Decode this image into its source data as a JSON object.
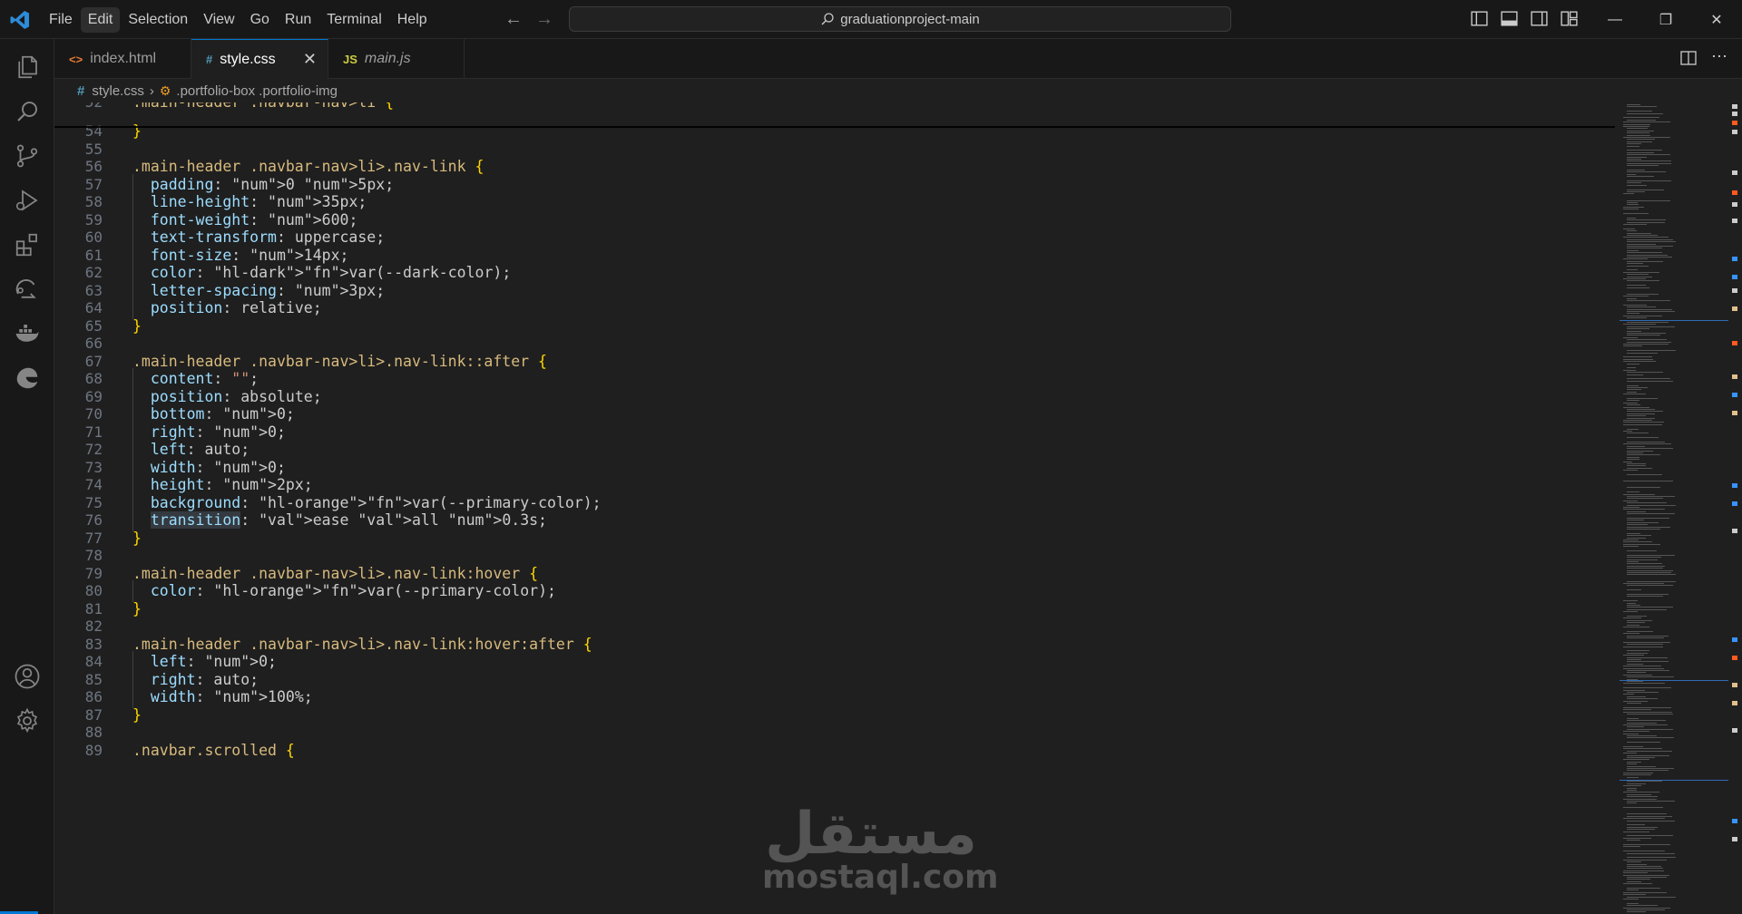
{
  "titlebar": {
    "menu": [
      "File",
      "Edit",
      "Selection",
      "View",
      "Go",
      "Run",
      "Terminal",
      "Help"
    ],
    "search_text": "graduationproject-main",
    "window_controls": [
      "minimize-icon",
      "restore-icon",
      "close-icon"
    ]
  },
  "activity_bar": [
    "explorer-icon",
    "search-icon",
    "source-control-icon",
    "run-debug-icon",
    "extensions-icon",
    "remote-explorer-icon",
    "docker-icon",
    "edge-icon",
    "accounts-icon",
    "manage-gear-icon"
  ],
  "tabs": [
    {
      "icon": "<>",
      "label": "index.html",
      "active": false
    },
    {
      "icon": "#",
      "label": "style.css",
      "active": true
    },
    {
      "icon": "JS",
      "label": "main.js",
      "active": false
    }
  ],
  "breadcrumb": {
    "file": "style.css",
    "symbol": ".portfolio-box .portfolio-img"
  },
  "editor": {
    "lines": [
      {
        "n": "52",
        "t": ".main-header .navbar-nav>li {"
      },
      {
        "n": "54",
        "t": "}"
      },
      {
        "n": "55",
        "t": ""
      },
      {
        "n": "56",
        "t": ".main-header .navbar-nav>li>.nav-link {"
      },
      {
        "n": "57",
        "t": "  padding: 0 5px;"
      },
      {
        "n": "58",
        "t": "  line-height: 35px;"
      },
      {
        "n": "59",
        "t": "  font-weight: 600;"
      },
      {
        "n": "60",
        "t": "  text-transform: uppercase;"
      },
      {
        "n": "61",
        "t": "  font-size: 14px;"
      },
      {
        "n": "62",
        "t": "  color: var(--dark-color);"
      },
      {
        "n": "63",
        "t": "  letter-spacing: 3px;"
      },
      {
        "n": "64",
        "t": "  position: relative;"
      },
      {
        "n": "65",
        "t": "}"
      },
      {
        "n": "66",
        "t": ""
      },
      {
        "n": "67",
        "t": ".main-header .navbar-nav>li>.nav-link::after {"
      },
      {
        "n": "68",
        "t": "  content: \"\";"
      },
      {
        "n": "69",
        "t": "  position: absolute;"
      },
      {
        "n": "70",
        "t": "  bottom: 0;"
      },
      {
        "n": "71",
        "t": "  right: 0;"
      },
      {
        "n": "72",
        "t": "  left: auto;"
      },
      {
        "n": "73",
        "t": "  width: 0;"
      },
      {
        "n": "74",
        "t": "  height: 2px;"
      },
      {
        "n": "75",
        "t": "  background: var(--primary-color);"
      },
      {
        "n": "76",
        "t": "  transition: ease all 0.3s;"
      },
      {
        "n": "77",
        "t": "}"
      },
      {
        "n": "78",
        "t": ""
      },
      {
        "n": "79",
        "t": ".main-header .navbar-nav>li>.nav-link:hover {"
      },
      {
        "n": "80",
        "t": "  color: var(--primary-color);"
      },
      {
        "n": "81",
        "t": "}"
      },
      {
        "n": "82",
        "t": ""
      },
      {
        "n": "83",
        "t": ".main-header .navbar-nav>li>.nav-link:hover:after {"
      },
      {
        "n": "84",
        "t": "  left: 0;"
      },
      {
        "n": "85",
        "t": "  right: auto;"
      },
      {
        "n": "86",
        "t": "  width: 100%;"
      },
      {
        "n": "87",
        "t": "}"
      },
      {
        "n": "88",
        "t": ""
      },
      {
        "n": "89",
        "t": ".navbar.scrolled {"
      }
    ]
  },
  "watermark": {
    "arabic": "مستقل",
    "latin": "mostaql.com"
  },
  "colors": {
    "accent": "#0078d4",
    "highlight": "#ff5a1f"
  }
}
